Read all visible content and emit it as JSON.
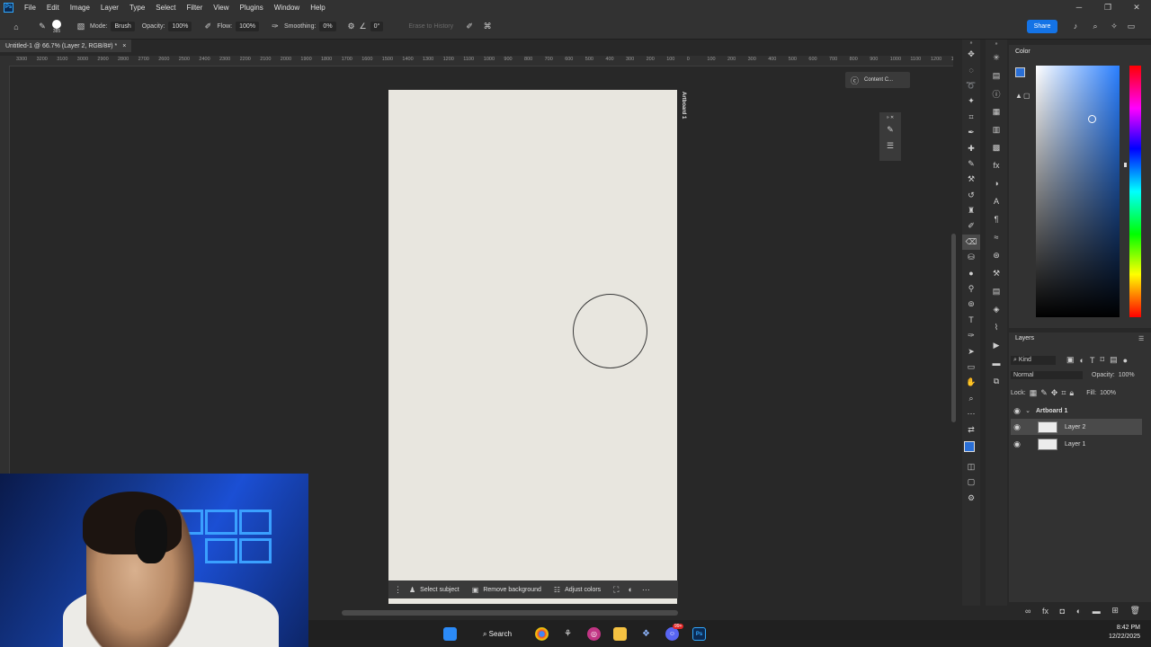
{
  "menubar": {
    "logo": "Ps",
    "items": [
      "File",
      "Edit",
      "Image",
      "Layer",
      "Type",
      "Select",
      "Filter",
      "View",
      "Plugins",
      "Window",
      "Help"
    ]
  },
  "options": {
    "brush_size": "385",
    "mode_label": "Mode:",
    "mode_value": "Brush",
    "opacity_label": "Opacity:",
    "opacity_value": "100%",
    "flow_label": "Flow:",
    "flow_value": "100%",
    "smoothing_label": "Smoothing:",
    "smoothing_value": "0%",
    "angle_value": "0°",
    "erase_history_label": "Erase to History",
    "share_label": "Share"
  },
  "document": {
    "tab_title": "Untitled-1 @ 66.7% (Layer 2, RGB/8#) *",
    "tab_close": "×",
    "artboard_label": "Artboard 1"
  },
  "ruler_labels": [
    "3300",
    "3200",
    "3100",
    "3000",
    "2900",
    "2800",
    "2700",
    "2600",
    "2500",
    "2400",
    "2300",
    "2200",
    "2100",
    "2000",
    "1900",
    "1800",
    "1700",
    "1600",
    "1500",
    "1400",
    "1300",
    "1200",
    "1100",
    "1000",
    "900",
    "800",
    "700",
    "600",
    "500",
    "400",
    "300",
    "200",
    "100",
    "0",
    "100",
    "200",
    "300",
    "400",
    "500",
    "600",
    "700",
    "800",
    "900",
    "1000",
    "1100",
    "1200",
    "1300"
  ],
  "content_credentials": "Content C...",
  "context_bar": {
    "select_subject": "Select subject",
    "remove_background": "Remove background",
    "adjust_colors": "Adjust colors"
  },
  "color_panel": {
    "title": "Color",
    "foreground": "#2a6fd6",
    "background": "#000000"
  },
  "layers_panel": {
    "title": "Layers",
    "filter_kind": "Kind",
    "blend_mode": "Normal",
    "opacity_label": "Opacity:",
    "opacity_value": "100%",
    "lock_label": "Lock:",
    "fill_label": "Fill:",
    "fill_value": "100%",
    "group_name": "Artboard 1",
    "layers": [
      {
        "name": "Layer 2"
      },
      {
        "name": "Layer 1"
      }
    ]
  },
  "taskbar": {
    "search_label": "Search",
    "time": "8:42 PM",
    "date": "12/22/2025",
    "notification_count": "99+"
  }
}
